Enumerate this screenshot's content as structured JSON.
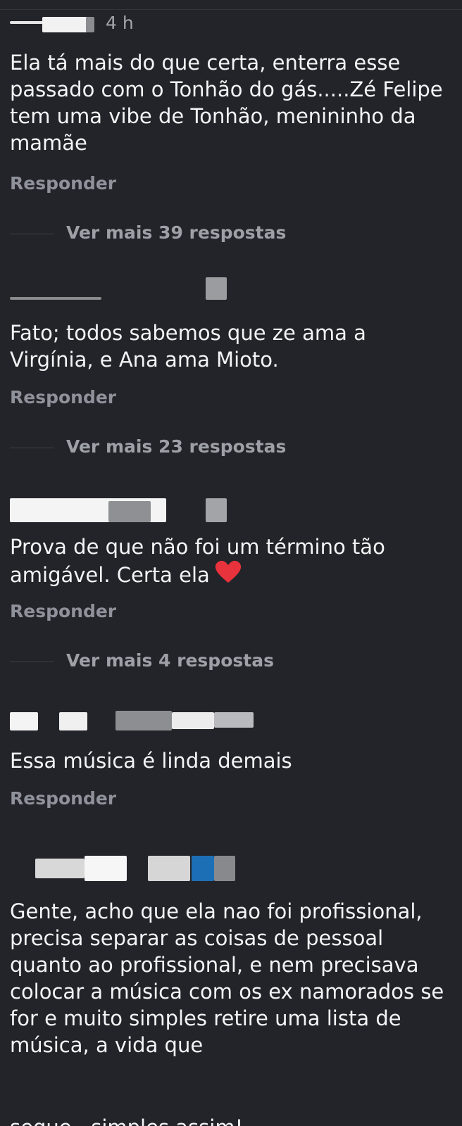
{
  "comments": [
    {
      "time": "4 h",
      "text": "Ela tá mais do que certa, enterra esse passado com o Tonhão do gás.....Zé Felipe tem uma vibe de Tonhão, menininho da mamãe",
      "reply_label": "Responder",
      "more_replies": "Ver mais 39 respostas"
    },
    {
      "text": "Fato; todos sabemos que ze ama a Virgínia, e Ana ama Mioto.",
      "reply_label": "Responder",
      "more_replies": "Ver mais 23 respostas"
    },
    {
      "text": "Prova de que não foi um término tão amigável. Certa ela",
      "emoji": "red-heart",
      "reply_label": "Responder",
      "more_replies": "Ver mais 4 respostas"
    },
    {
      "text": "Essa música é linda demais",
      "reply_label": "Responder"
    },
    {
      "text": "Gente, acho que ela nao foi profissional,  precisa separar as coisas de pessoal quanto ao profissional,  e nem precisava colocar a música com os ex namorados  se for e muito simples retire uma lista de música, a vida que",
      "cut_text": "segue...simples assim!"
    }
  ],
  "colors": {
    "background": "#232429",
    "text": "#f3f4f6",
    "secondary": "#8f929a",
    "heart": "#e8323c"
  }
}
